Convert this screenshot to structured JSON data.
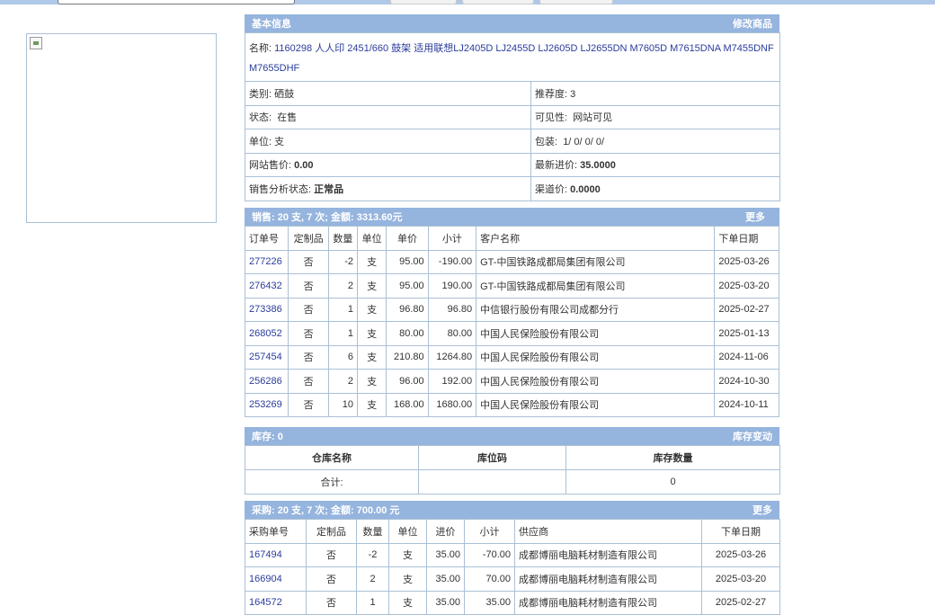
{
  "basic": {
    "header": "基本信息",
    "edit_link": "修改商品",
    "name_label": "名称:",
    "name_value": "1160298 人人印 2451/660 鼓架 适用联想LJ2405D LJ2455D LJ2605D LJ2655DN M7605D M7615DNA M7455DNF M7655DHF",
    "category_label": "类别:",
    "category_value": "硒鼓",
    "recommend_label": "推荐度:",
    "recommend_value": "3",
    "status_label": "状态:",
    "status_value": "在售",
    "visibility_label": "可见性:",
    "visibility_value": "网站可见",
    "unit_label": "单位:",
    "unit_value": "支",
    "package_label": "包装:",
    "package_value": "1/ 0/ 0/ 0/",
    "web_price_label": "网站售价:",
    "web_price_value": "0.00",
    "latest_cost_label": "最新进价:",
    "latest_cost_value": "35.0000",
    "sales_status_label": "销售分析状态:",
    "sales_status_value": "正常品",
    "channel_price_label": "渠道价:",
    "channel_price_value": "0.0000"
  },
  "sales": {
    "header": "销售: 20 支, 7 次; 金额: 3313.60元",
    "more": "更多",
    "columns": [
      "订单号",
      "定制品",
      "数量",
      "单位",
      "单价",
      "小计",
      "客户名称",
      "下单日期"
    ],
    "rows": [
      {
        "id": "277226",
        "custom": "否",
        "qty": "-2",
        "unit": "支",
        "price": "95.00",
        "subtotal": "-190.00",
        "customer": "GT-中国铁路成都局集团有限公司",
        "date": "2025-03-26"
      },
      {
        "id": "276432",
        "custom": "否",
        "qty": "2",
        "unit": "支",
        "price": "95.00",
        "subtotal": "190.00",
        "customer": "GT-中国铁路成都局集团有限公司",
        "date": "2025-03-20"
      },
      {
        "id": "273386",
        "custom": "否",
        "qty": "1",
        "unit": "支",
        "price": "96.80",
        "subtotal": "96.80",
        "customer": "中信银行股份有限公司成都分行",
        "date": "2025-02-27"
      },
      {
        "id": "268052",
        "custom": "否",
        "qty": "1",
        "unit": "支",
        "price": "80.00",
        "subtotal": "80.00",
        "customer": "中国人民保险股份有限公司",
        "date": "2025-01-13"
      },
      {
        "id": "257454",
        "custom": "否",
        "qty": "6",
        "unit": "支",
        "price": "210.80",
        "subtotal": "1264.80",
        "customer": "中国人民保险股份有限公司",
        "date": "2024-11-06"
      },
      {
        "id": "256286",
        "custom": "否",
        "qty": "2",
        "unit": "支",
        "price": "96.00",
        "subtotal": "192.00",
        "customer": "中国人民保险股份有限公司",
        "date": "2024-10-30"
      },
      {
        "id": "253269",
        "custom": "否",
        "qty": "10",
        "unit": "支",
        "price": "168.00",
        "subtotal": "1680.00",
        "customer": "中国人民保险股份有限公司",
        "date": "2024-10-11"
      }
    ]
  },
  "stock": {
    "header": "库存: 0",
    "change_link": "库存变动",
    "columns": [
      "仓库名称",
      "库位码",
      "库存数量"
    ],
    "total_label": "合计:",
    "total_location": "",
    "total_qty": "0"
  },
  "purchase": {
    "header": "采购: 20 支, 7 次; 金额: 700.00 元",
    "more": "更多",
    "columns": [
      "采购单号",
      "定制品",
      "数量",
      "单位",
      "进价",
      "小计",
      "供应商",
      "下单日期"
    ],
    "rows": [
      {
        "id": "167494",
        "custom": "否",
        "qty": "-2",
        "unit": "支",
        "price": "35.00",
        "subtotal": "-70.00",
        "supplier": "成都博丽电脑耗材制造有限公司",
        "date": "2025-03-26"
      },
      {
        "id": "166904",
        "custom": "否",
        "qty": "2",
        "unit": "支",
        "price": "35.00",
        "subtotal": "70.00",
        "supplier": "成都博丽电脑耗材制造有限公司",
        "date": "2025-03-20"
      },
      {
        "id": "164572",
        "custom": "否",
        "qty": "1",
        "unit": "支",
        "price": "35.00",
        "subtotal": "35.00",
        "supplier": "成都博丽电脑耗材制造有限公司",
        "date": "2025-02-27"
      }
    ]
  }
}
